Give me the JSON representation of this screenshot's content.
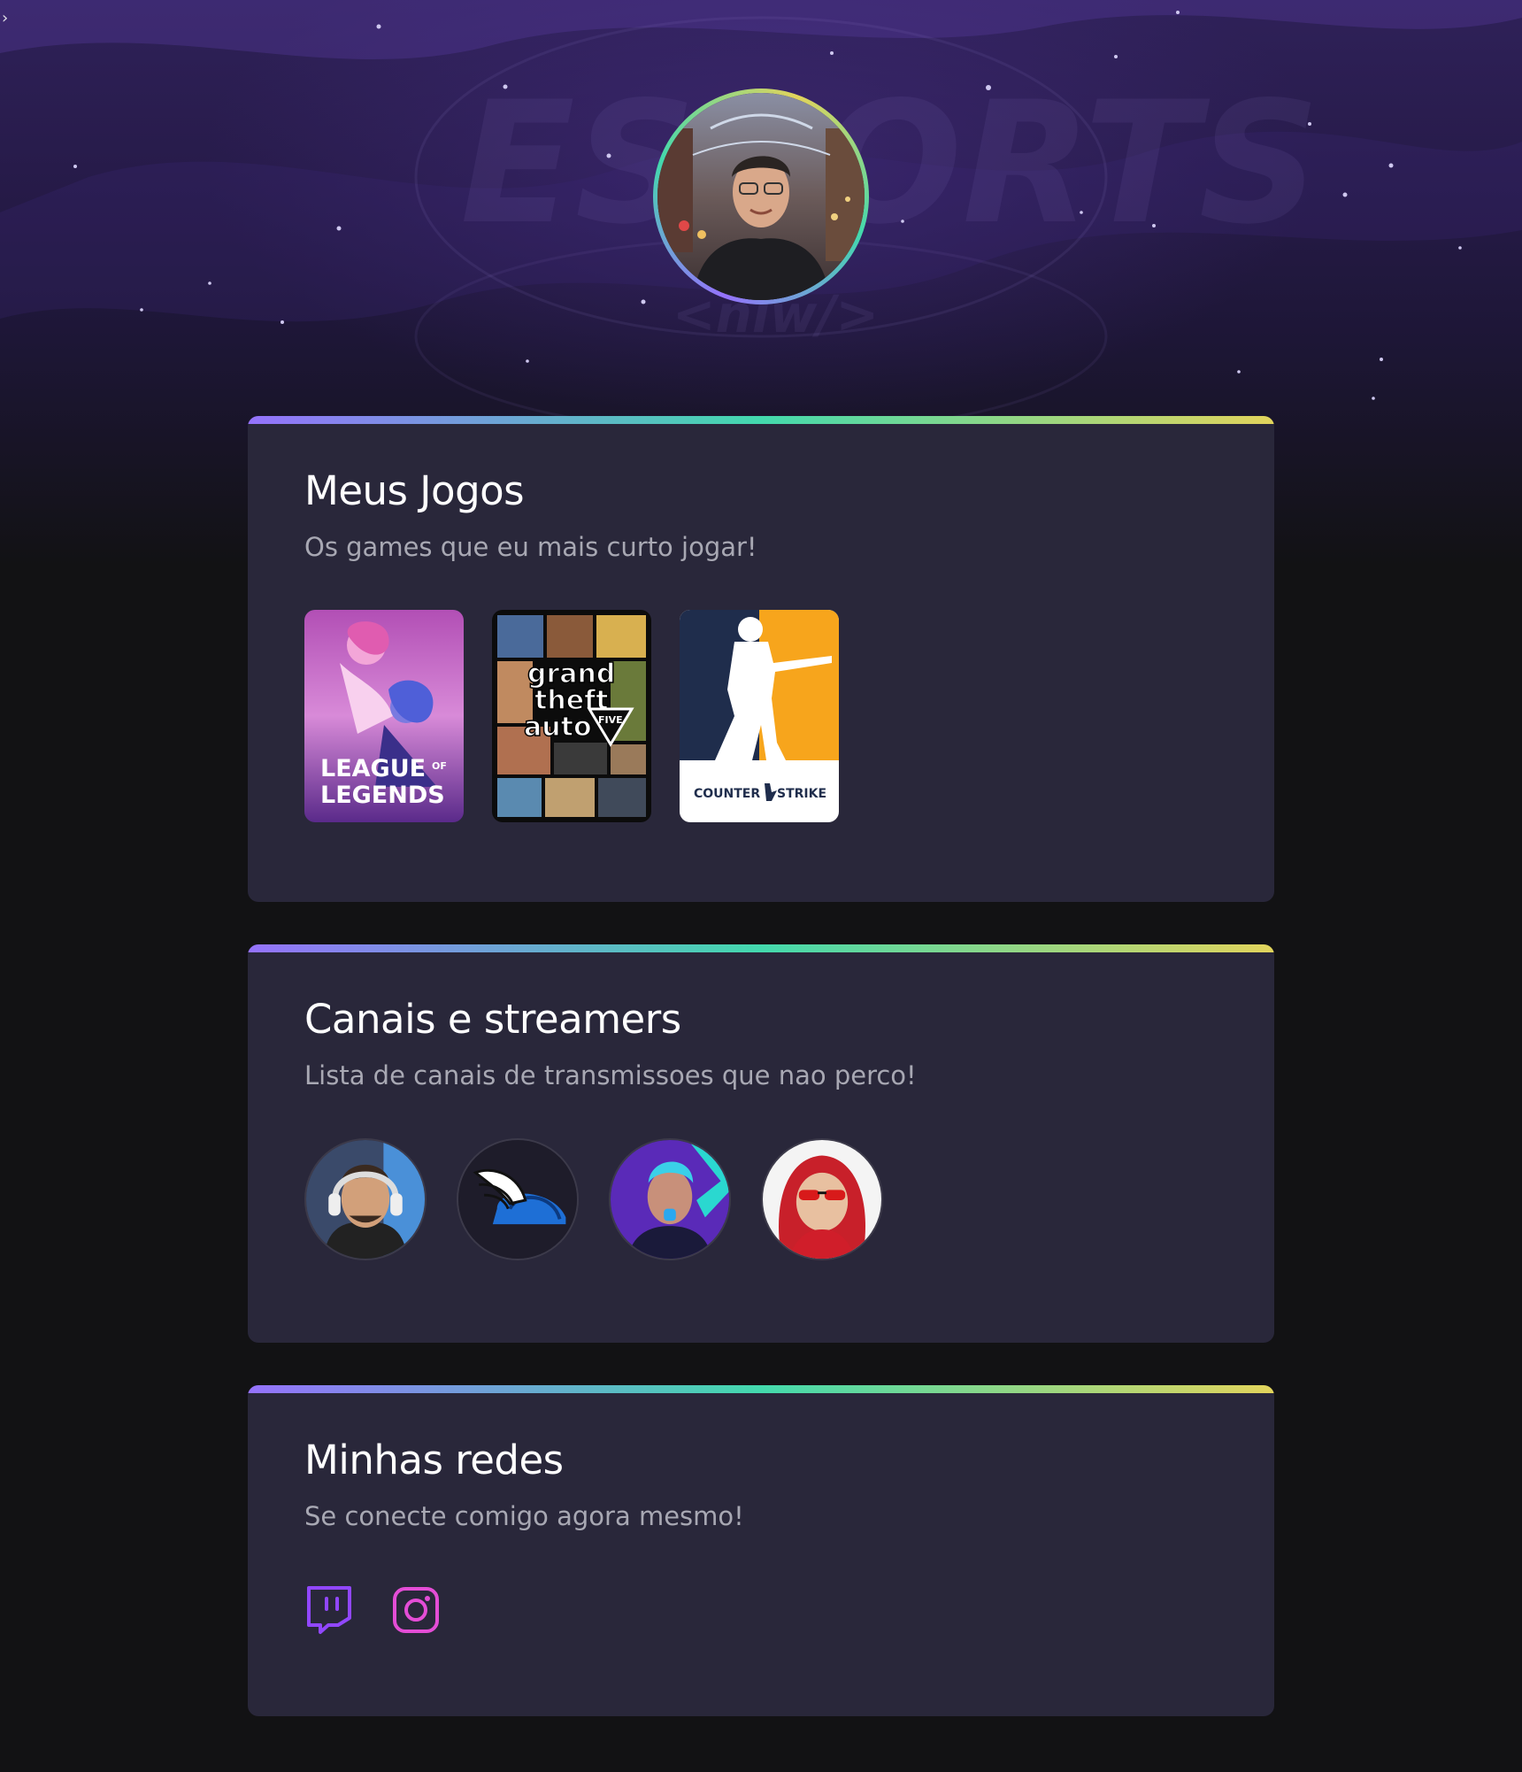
{
  "header": {
    "caret": "›",
    "avatar_alt": "profile-photo"
  },
  "games_card": {
    "title": "Meus Jogos",
    "subtitle": "Os games que eu mais curto jogar!",
    "games": [
      {
        "name": "League of Legends",
        "line1": "LEAGUE",
        "of": "OF",
        "line2": "LEGENDS"
      },
      {
        "name": "Grand Theft Auto V",
        "line1": "grand",
        "line2": "theft",
        "line3": "auto",
        "badge": "FIVE"
      },
      {
        "name": "Counter-Strike: Global Offensive",
        "line1": "COUNTER",
        "line2": "STRIKE"
      }
    ]
  },
  "streamers_card": {
    "title": "Canais e streamers",
    "subtitle": "Lista de canais de transmissoes que nao perco!",
    "streamers": [
      "streamer-1",
      "streamer-2",
      "streamer-3",
      "streamer-4"
    ]
  },
  "socials_card": {
    "title": "Minhas redes",
    "subtitle": "Se conecte comigo agora mesmo!",
    "links": [
      {
        "icon": "twitch-icon",
        "color": "#9147ff"
      },
      {
        "icon": "instagram-icon",
        "color": "#e44dd6"
      }
    ]
  },
  "colors": {
    "background": "#121214",
    "card": "#29273a",
    "gradient": [
      "#9572fc",
      "#43d9ad",
      "#e2d45c"
    ]
  }
}
